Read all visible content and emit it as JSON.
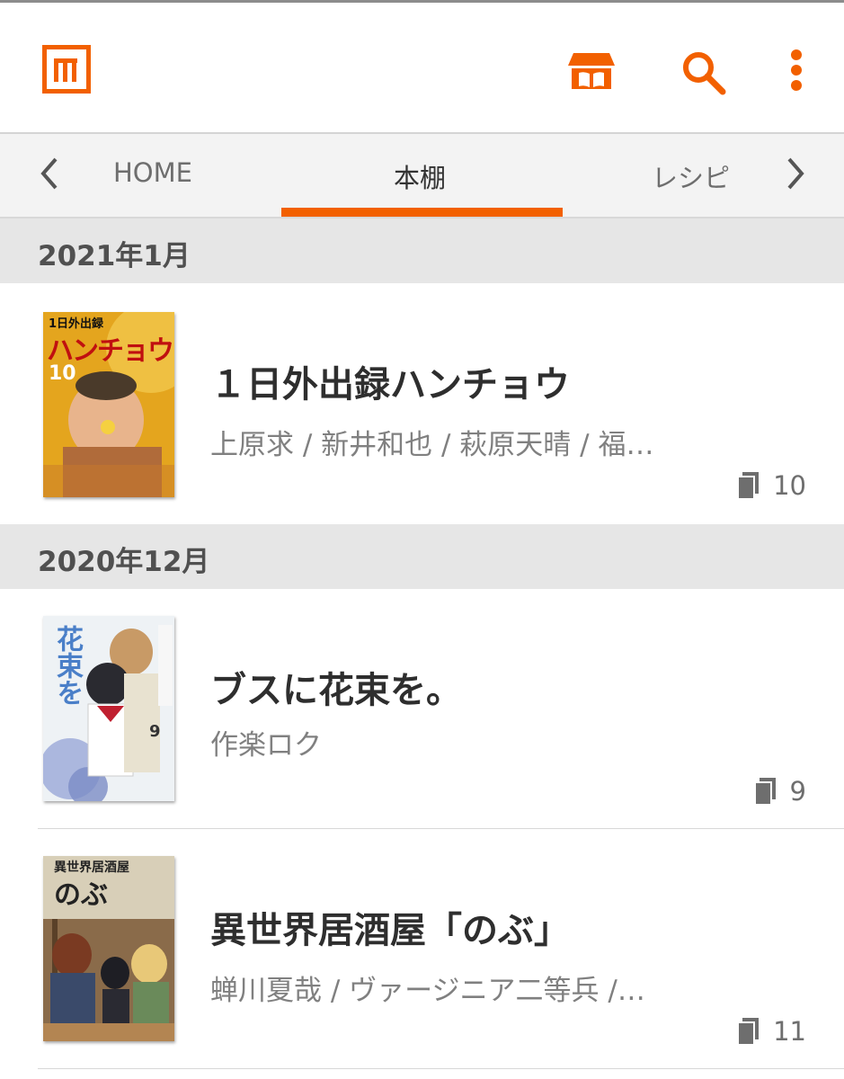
{
  "appbar": {
    "logo_icon": "bookshelf-logo-icon",
    "store_icon": "store-icon",
    "search_icon": "search-icon",
    "menu_icon": "more-vert-icon",
    "accent_color": "#f26000"
  },
  "tabs": {
    "prev_icon": "chevron-left-icon",
    "next_icon": "chevron-right-icon",
    "items": [
      {
        "label": "HOME"
      },
      {
        "label": "本棚"
      },
      {
        "label": "レシピ"
      }
    ],
    "active_index": 1
  },
  "sections": [
    {
      "header": "2021年1月",
      "items": [
        {
          "title": "１日外出録ハンチョウ",
          "authors": "上原求 / 新井和也 / 萩原天晴 / 福…",
          "count": "10",
          "count_icon": "books-icon",
          "cover": {
            "title": "1日外出録",
            "big": "ハンチョウ",
            "volume": "10",
            "bg": "#d89a1a"
          }
        }
      ]
    },
    {
      "header": "2020年12月",
      "items": [
        {
          "title": "ブスに花束を。",
          "authors": "作楽ロク",
          "count": "9",
          "count_icon": "books-icon",
          "cover": {
            "big": "花束を",
            "volume": "9",
            "bg": "#e9eef2"
          }
        },
        {
          "title": "異世界居酒屋「のぶ」",
          "authors": "蝉川夏哉 / ヴァージニア二等兵 /…",
          "count": "11",
          "count_icon": "books-icon",
          "cover": {
            "title": "異世界居酒屋",
            "big": "のぶ",
            "bg": "#8a6b4a"
          }
        }
      ]
    }
  ]
}
